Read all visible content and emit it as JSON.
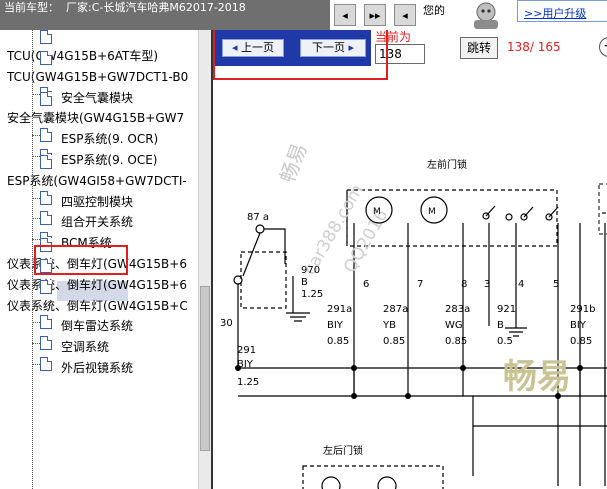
{
  "header": {
    "title": "当前车型：  厂家:C-长城汽车哈弗M62017-2018",
    "nav_first": "◂",
    "nav_next": "▸▸",
    "nav_last": "◂",
    "user_text": "您的",
    "link_text": ">>用户升级"
  },
  "tree": {
    "items": [
      {
        "label": "TCU(GW4G15B+6AT车型)",
        "level": 0
      },
      {
        "label": "TCU(GW4G15B+GW7DCT1-B0",
        "level": 0
      },
      {
        "label": "安全气囊模块",
        "level": 1
      },
      {
        "label": "安全气囊模块(GW4G15B+GW7",
        "level": 0
      },
      {
        "label": "ESP系统(9. OCR)",
        "level": 1
      },
      {
        "label": "ESP系统(9. OCE)",
        "level": 1
      },
      {
        "label": "ESP系统(GW4GI58+GW7DCTI-",
        "level": 0
      },
      {
        "label": "四驱控制模块",
        "level": 1
      },
      {
        "label": "组合开关系统",
        "level": 1
      },
      {
        "label": "BCM系统",
        "level": 1,
        "selected": true
      },
      {
        "label": "仪表系统、倒车灯(GW4G15B+6",
        "level": 0
      },
      {
        "label": "仪表系统、倒车灯(GW4G15B+6",
        "level": 0
      },
      {
        "label": "仪表系统、倒车灯(GW4G15B+C",
        "level": 0
      },
      {
        "label": "倒车雷达系统",
        "level": 1
      },
      {
        "label": "空调系统",
        "level": 1
      },
      {
        "label": "外后视镜系统",
        "level": 1
      }
    ]
  },
  "pager": {
    "prev_label": "上一页",
    "next_label": "下一页",
    "current_label": "当前为",
    "current_value": "138",
    "jump_label": "跳转",
    "page_count": "138/ 165"
  },
  "diagram": {
    "title_front": "左前门锁",
    "title_rear": "左后门锁",
    "watermark_1": "畅易",
    "watermark_2": "畅易",
    "watermark_3": "car388.com",
    "watermark_4": "QQ2016",
    "relay_pin": "87 a",
    "pin_30": "30",
    "wire_970": "970",
    "wire_970_color": "B",
    "wire_970_size": "1.25",
    "wire_291": "291",
    "wire_291_color": "BIY",
    "wire_291_size": "1.25",
    "conn_pins": [
      "6",
      "7",
      "8",
      "3",
      "4",
      "5"
    ],
    "wires": [
      {
        "num": "291a",
        "color": "BIY",
        "size": "0.85"
      },
      {
        "num": "287a",
        "color": "YB",
        "size": "0.85"
      },
      {
        "num": "283a",
        "color": "WG",
        "size": "0.85"
      },
      {
        "num": "921",
        "color": "B",
        "size": "0.5"
      },
      {
        "num": "291b",
        "color": "BIY",
        "size": "0.85"
      }
    ],
    "motor_label": "M"
  }
}
